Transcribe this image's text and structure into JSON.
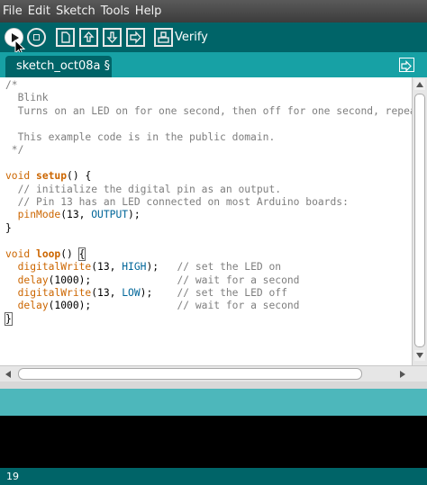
{
  "menu": {
    "items": [
      "File",
      "Edit",
      "Sketch",
      "Tools",
      "Help"
    ]
  },
  "toolbar": {
    "hover_label": "Verify",
    "buttons": [
      "verify-icon",
      "stop-icon",
      "new-icon",
      "open-icon",
      "save-icon",
      "upload-icon",
      "serial-monitor-icon"
    ]
  },
  "tabs": {
    "active_tab": "sketch_oct08a §"
  },
  "editor": {
    "lines": [
      [
        {
          "t": "/*",
          "c": "comment"
        }
      ],
      [
        {
          "t": "  Blink",
          "c": "comment"
        }
      ],
      [
        {
          "t": "  Turns on an LED on for one second, then off for one second, repeat",
          "c": "comment"
        }
      ],
      [
        {
          "t": "",
          "c": "plain"
        }
      ],
      [
        {
          "t": "  This example code is in the public domain.",
          "c": "comment"
        }
      ],
      [
        {
          "t": " */",
          "c": "comment"
        }
      ],
      [
        {
          "t": "",
          "c": "plain"
        }
      ],
      [
        {
          "t": "void",
          "c": "type"
        },
        {
          "t": " ",
          "c": "plain"
        },
        {
          "t": "setup",
          "c": "funcbold"
        },
        {
          "t": "() {",
          "c": "plain"
        }
      ],
      [
        {
          "t": "  // initialize the digital pin as an output.",
          "c": "comment"
        }
      ],
      [
        {
          "t": "  // Pin 13 has an LED connected on most Arduino boards:",
          "c": "comment"
        }
      ],
      [
        {
          "t": "  ",
          "c": "plain"
        },
        {
          "t": "pinMode",
          "c": "func"
        },
        {
          "t": "(13, ",
          "c": "plain"
        },
        {
          "t": "OUTPUT",
          "c": "const"
        },
        {
          "t": ");",
          "c": "plain"
        }
      ],
      [
        {
          "t": "}",
          "c": "plain"
        }
      ],
      [
        {
          "t": "",
          "c": "plain"
        }
      ],
      [
        {
          "t": "void",
          "c": "type"
        },
        {
          "t": " ",
          "c": "plain"
        },
        {
          "t": "loop",
          "c": "funcbold"
        },
        {
          "t": "() ",
          "c": "plain"
        },
        {
          "t": "{",
          "c": "bracket"
        }
      ],
      [
        {
          "t": "  ",
          "c": "plain"
        },
        {
          "t": "digitalWrite",
          "c": "func"
        },
        {
          "t": "(13, ",
          "c": "plain"
        },
        {
          "t": "HIGH",
          "c": "const"
        },
        {
          "t": ");   ",
          "c": "plain"
        },
        {
          "t": "// set the LED on",
          "c": "comment"
        }
      ],
      [
        {
          "t": "  ",
          "c": "plain"
        },
        {
          "t": "delay",
          "c": "func"
        },
        {
          "t": "(1000);              ",
          "c": "plain"
        },
        {
          "t": "// wait for a second",
          "c": "comment"
        }
      ],
      [
        {
          "t": "  ",
          "c": "plain"
        },
        {
          "t": "digitalWrite",
          "c": "func"
        },
        {
          "t": "(13, ",
          "c": "plain"
        },
        {
          "t": "LOW",
          "c": "const"
        },
        {
          "t": ");    ",
          "c": "plain"
        },
        {
          "t": "// set the LED off",
          "c": "comment"
        }
      ],
      [
        {
          "t": "  ",
          "c": "plain"
        },
        {
          "t": "delay",
          "c": "func"
        },
        {
          "t": "(1000);              ",
          "c": "plain"
        },
        {
          "t": "// wait for a second",
          "c": "comment"
        }
      ],
      [
        {
          "t": "}",
          "c": "bracket"
        }
      ]
    ]
  },
  "status": {
    "line_number": "19"
  },
  "colors": {
    "toolbar_bg": "#006468",
    "tab_bar_bg": "#17a1a5",
    "message_area_bg": "#4db7bb",
    "keyword": "#cc6600",
    "constant": "#006699",
    "comment": "#7e7e7e"
  }
}
